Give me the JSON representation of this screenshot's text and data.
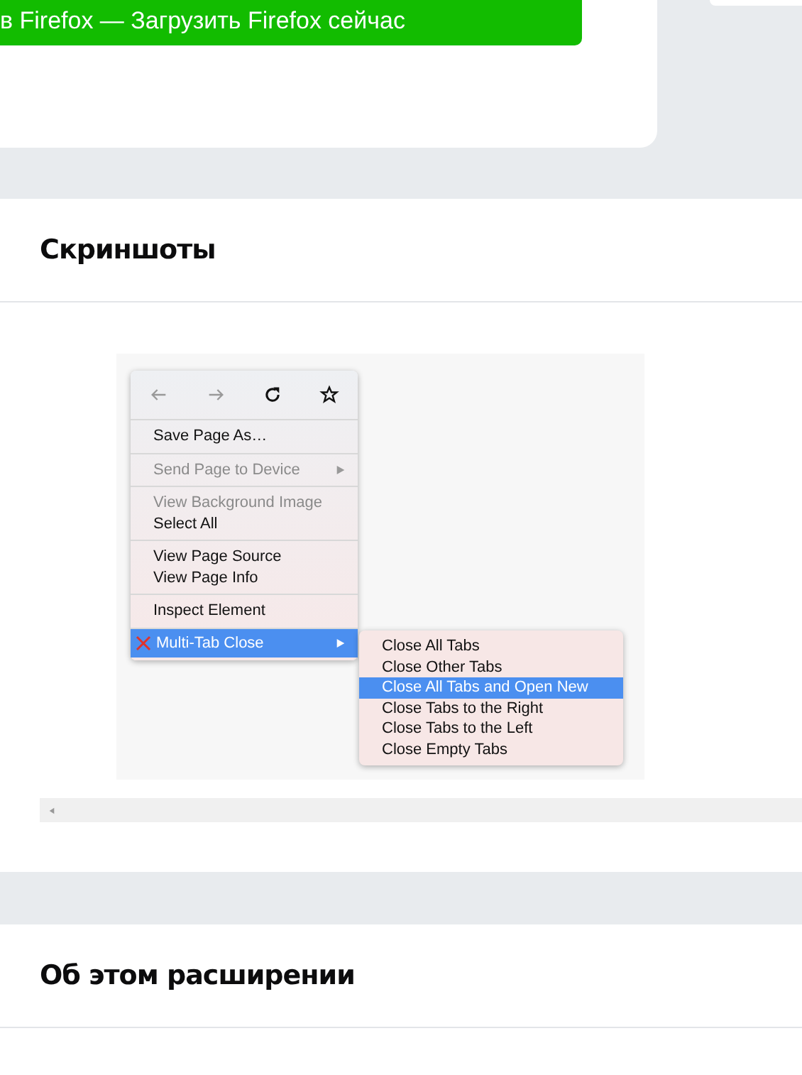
{
  "top_card": {
    "download_button": "в Firefox — Загрузить Firefox сейчас"
  },
  "screenshots_section": {
    "title": "Скриншоты",
    "screenshot": {
      "context_menu": {
        "groups": [
          [
            {
              "label": "Save Page As…",
              "disabled": false,
              "submenu": false,
              "selected": false
            }
          ],
          [
            {
              "label": "Send Page to Device",
              "disabled": true,
              "submenu": true,
              "selected": false
            }
          ],
          [
            {
              "label": "View Background Image",
              "disabled": true,
              "submenu": false,
              "selected": false
            },
            {
              "label": "Select All",
              "disabled": false,
              "submenu": false,
              "selected": false
            }
          ],
          [
            {
              "label": "View Page Source",
              "disabled": false,
              "submenu": false,
              "selected": false
            },
            {
              "label": "View Page Info",
              "disabled": false,
              "submenu": false,
              "selected": false
            }
          ],
          [
            {
              "label": "Inspect Element",
              "disabled": false,
              "submenu": false,
              "selected": false
            }
          ],
          [
            {
              "label": "Multi-Tab Close",
              "disabled": false,
              "submenu": true,
              "selected": true,
              "kind": "extension"
            }
          ]
        ]
      },
      "submenu": [
        {
          "label": "Close All Tabs",
          "selected": false
        },
        {
          "label": "Close Other Tabs",
          "selected": false
        },
        {
          "label": "Close All Tabs and Open New",
          "selected": true
        },
        {
          "label": "Close Tabs to the Right",
          "selected": false
        },
        {
          "label": "Close Tabs to the Left",
          "selected": false
        },
        {
          "label": "Close Empty Tabs",
          "selected": false
        }
      ]
    }
  },
  "about_section": {
    "title": "Об этом расширении"
  }
}
